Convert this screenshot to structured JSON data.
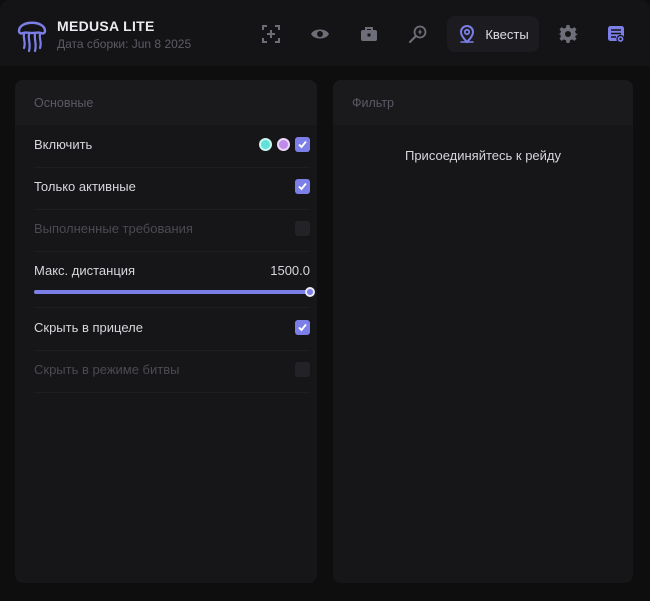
{
  "app": {
    "title": "MEDUSA LITE",
    "build": "Дата сборки: Jun 8 2025"
  },
  "toolbar": {
    "items": [
      {
        "icon": "crosshair-icon"
      },
      {
        "icon": "eye-icon"
      },
      {
        "icon": "briefcase-icon"
      },
      {
        "icon": "search-magic-icon"
      },
      {
        "icon": "map-pin-icon",
        "label": "Квесты",
        "active": true
      },
      {
        "icon": "gear-icon"
      },
      {
        "icon": "config-list-icon"
      }
    ]
  },
  "panels": {
    "main": {
      "title": "Основные",
      "rows": {
        "enable": {
          "label": "Включить",
          "checked": true,
          "colors": [
            "#5fe0d8",
            "#c08ae8"
          ]
        },
        "only_active": {
          "label": "Только активные",
          "checked": true
        },
        "completed": {
          "label": "Выполненные требования",
          "checked": false,
          "disabled": true
        },
        "max_distance": {
          "label": "Макс. дистанция",
          "value": "1500.0",
          "slider_fraction": 1.0
        },
        "hide_aim": {
          "label": "Скрыть в прицеле",
          "checked": true
        },
        "hide_battle": {
          "label": "Скрыть в режиме битвы",
          "checked": false,
          "disabled": true
        }
      }
    },
    "filter": {
      "title": "Фильтр",
      "message": "Присоединяйтесь к рейду"
    }
  },
  "colors": {
    "accent": "#7c7fe8",
    "background": "#0e0e0f",
    "panel": "#161618"
  }
}
